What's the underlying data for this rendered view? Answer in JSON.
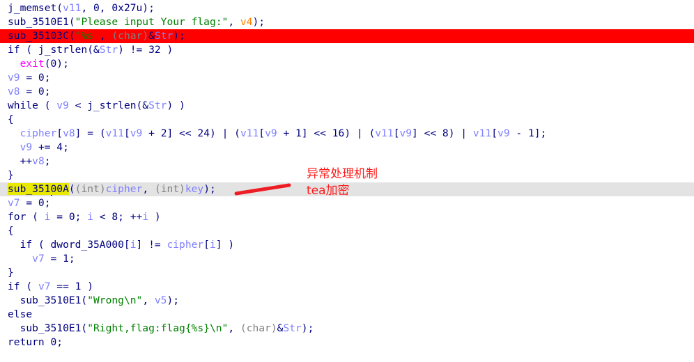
{
  "colors": {
    "breakpoint_line": "#ff0000",
    "current_line": "#e3e3e3",
    "highlight": "#e8e800",
    "annotation": "#ff1a1a"
  },
  "lines": [
    {
      "tokens": [
        [
          "j_memset(",
          "plain"
        ],
        [
          "v11",
          "var"
        ],
        [
          ", 0, 0x27u);",
          "plain"
        ]
      ]
    },
    {
      "tokens": [
        [
          "sub_3510E1(",
          "plain"
        ],
        [
          "\"Please input Your flag:\"",
          "str"
        ],
        [
          ", ",
          "plain"
        ],
        [
          "v4",
          "lvar"
        ],
        [
          ");",
          "plain"
        ]
      ]
    },
    {
      "state": "breakpoint",
      "tokens": [
        [
          "sub_35103C(",
          "plain"
        ],
        [
          "\"%s\"",
          "str"
        ],
        [
          ", ",
          "plain"
        ],
        [
          "(char)",
          "type"
        ],
        [
          "&",
          "plain"
        ],
        [
          "Str",
          "var"
        ],
        [
          ");",
          "plain"
        ]
      ]
    },
    {
      "tokens": [
        [
          "if ( j_strlen(&",
          "plain"
        ],
        [
          "Str",
          "var"
        ],
        [
          ") != 32 )",
          "plain"
        ]
      ]
    },
    {
      "tokens": [
        [
          "  ",
          "plain"
        ],
        [
          "exit",
          "imp"
        ],
        [
          "(0);",
          "plain"
        ]
      ]
    },
    {
      "tokens": [
        [
          "v9",
          "var"
        ],
        [
          " = 0;",
          "plain"
        ]
      ]
    },
    {
      "tokens": [
        [
          "v8",
          "var"
        ],
        [
          " = 0;",
          "plain"
        ]
      ]
    },
    {
      "tokens": [
        [
          "while ( ",
          "plain"
        ],
        [
          "v9",
          "var"
        ],
        [
          " < j_strlen(&",
          "plain"
        ],
        [
          "Str",
          "var"
        ],
        [
          ") )",
          "plain"
        ]
      ]
    },
    {
      "tokens": [
        [
          "{",
          "plain"
        ]
      ]
    },
    {
      "tokens": [
        [
          "  ",
          "plain"
        ],
        [
          "cipher",
          "var"
        ],
        [
          "[",
          "plain"
        ],
        [
          "v8",
          "var"
        ],
        [
          "] = (",
          "plain"
        ],
        [
          "v11",
          "var"
        ],
        [
          "[",
          "plain"
        ],
        [
          "v9",
          "var"
        ],
        [
          " + 2] << 24) | (",
          "plain"
        ],
        [
          "v11",
          "var"
        ],
        [
          "[",
          "plain"
        ],
        [
          "v9",
          "var"
        ],
        [
          " + 1] << 16) | (",
          "plain"
        ],
        [
          "v11",
          "var"
        ],
        [
          "[",
          "plain"
        ],
        [
          "v9",
          "var"
        ],
        [
          "] << 8) | ",
          "plain"
        ],
        [
          "v11",
          "var"
        ],
        [
          "[",
          "plain"
        ],
        [
          "v9",
          "var"
        ],
        [
          " - 1];",
          "plain"
        ]
      ]
    },
    {
      "tokens": [
        [
          "  ",
          "plain"
        ],
        [
          "v9",
          "var"
        ],
        [
          " += 4;",
          "plain"
        ]
      ]
    },
    {
      "tokens": [
        [
          "  ++",
          "plain"
        ],
        [
          "v8",
          "var"
        ],
        [
          ";",
          "plain"
        ]
      ]
    },
    {
      "tokens": [
        [
          "}",
          "plain"
        ]
      ]
    },
    {
      "state": "current",
      "tokens": [
        [
          "sub_351",
          "plain hl"
        ],
        [
          "|",
          "caret"
        ],
        [
          "00A",
          "plain hl"
        ],
        [
          "(",
          "plain"
        ],
        [
          "(int)",
          "type"
        ],
        [
          "cipher",
          "var"
        ],
        [
          ", ",
          "plain"
        ],
        [
          "(int)",
          "type"
        ],
        [
          "key",
          "var"
        ],
        [
          ");",
          "plain"
        ]
      ]
    },
    {
      "tokens": [
        [
          "v7",
          "var"
        ],
        [
          " = 0;",
          "plain"
        ]
      ]
    },
    {
      "tokens": [
        [
          "for ( ",
          "plain"
        ],
        [
          "i",
          "var"
        ],
        [
          " = 0; ",
          "plain"
        ],
        [
          "i",
          "var"
        ],
        [
          " < 8; ++",
          "plain"
        ],
        [
          "i",
          "var"
        ],
        [
          " )",
          "plain"
        ]
      ]
    },
    {
      "tokens": [
        [
          "{",
          "plain"
        ]
      ]
    },
    {
      "tokens": [
        [
          "  if ( dword_35A000[",
          "plain"
        ],
        [
          "i",
          "var"
        ],
        [
          "] != ",
          "plain"
        ],
        [
          "cipher",
          "var"
        ],
        [
          "[",
          "plain"
        ],
        [
          "i",
          "var"
        ],
        [
          "] )",
          "plain"
        ]
      ]
    },
    {
      "tokens": [
        [
          "    ",
          "plain"
        ],
        [
          "v7",
          "var"
        ],
        [
          " = 1;",
          "plain"
        ]
      ]
    },
    {
      "tokens": [
        [
          "}",
          "plain"
        ]
      ]
    },
    {
      "tokens": [
        [
          "if ( ",
          "plain"
        ],
        [
          "v7",
          "var"
        ],
        [
          " == 1 )",
          "plain"
        ]
      ]
    },
    {
      "tokens": [
        [
          "  sub_3510E1(",
          "plain"
        ],
        [
          "\"Wrong\\n\"",
          "str"
        ],
        [
          ", ",
          "plain"
        ],
        [
          "v5",
          "var"
        ],
        [
          ");",
          "plain"
        ]
      ]
    },
    {
      "tokens": [
        [
          "else",
          "plain"
        ]
      ]
    },
    {
      "tokens": [
        [
          "  sub_3510E1(",
          "plain"
        ],
        [
          "\"Right,flag:flag{%s}\\n\"",
          "str"
        ],
        [
          ", ",
          "plain"
        ],
        [
          "(char)",
          "type"
        ],
        [
          "&",
          "plain"
        ],
        [
          "Str",
          "var"
        ],
        [
          ");",
          "plain"
        ]
      ]
    },
    {
      "tokens": [
        [
          "return 0;",
          "plain"
        ]
      ]
    }
  ],
  "annotation": {
    "line1": "异常处理机制",
    "line2": "tea加密"
  }
}
